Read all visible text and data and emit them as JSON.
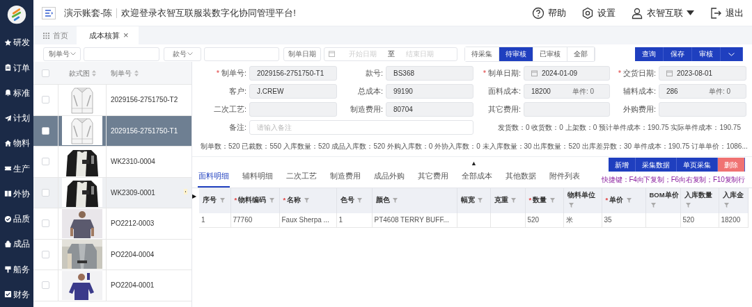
{
  "sidebar": {
    "items": [
      {
        "label": "研发"
      },
      {
        "label": "订单"
      },
      {
        "label": "标准"
      },
      {
        "label": "计划"
      },
      {
        "label": "物料"
      },
      {
        "label": "生产"
      },
      {
        "label": "外协"
      },
      {
        "label": "品质"
      },
      {
        "label": "成品"
      },
      {
        "label": "船务"
      },
      {
        "label": "财务"
      }
    ]
  },
  "header": {
    "account": "演示账套-陈",
    "welcome": "欢迎登录衣智互联服装数字化协同管理平台!",
    "actions": [
      {
        "kind": "help",
        "label": "帮助"
      },
      {
        "kind": "settings",
        "label": "设置"
      },
      {
        "kind": "user",
        "label": "衣智互联"
      },
      {
        "kind": "logout",
        "label": "退出"
      }
    ]
  },
  "page_tabs": [
    {
      "label": "首页",
      "selected": false
    },
    {
      "label": "成本核算",
      "selected": true,
      "close": "×"
    }
  ],
  "filters": {
    "order_select": "制单号",
    "style_select": "款号",
    "date_label": "制单日期",
    "start_placeholder": "开始日期",
    "range_sep": "至",
    "end_placeholder": "结束日期"
  },
  "status_filter": [
    {
      "label": "待采集",
      "selected": false
    },
    {
      "label": "待审核",
      "selected": true
    },
    {
      "label": "已审核",
      "selected": false
    },
    {
      "label": "全部",
      "selected": false
    }
  ],
  "actions": [
    {
      "label": "查询"
    },
    {
      "label": "保存"
    },
    {
      "label": "审核"
    }
  ],
  "required_mark": "*",
  "order_list": {
    "columns": [
      "款式图",
      "制单号"
    ],
    "select_all_checked": false,
    "rows": [
      {
        "order_no": "2029156-2751750-T2",
        "selected": false,
        "hovered": false
      },
      {
        "order_no": "2029156-2751750-T1",
        "selected": true,
        "hovered": false
      },
      {
        "order_no": "WK2310-0004",
        "selected": false,
        "hovered": false
      },
      {
        "order_no": "WK2309-0001",
        "selected": false,
        "hovered": true
      },
      {
        "order_no": "PO2212-0003",
        "selected": false,
        "hovered": false
      },
      {
        "order_no": "PO2204-0004",
        "selected": false,
        "hovered": false
      },
      {
        "order_no": "PO2204-0001",
        "selected": false,
        "hovered": false
      }
    ]
  },
  "form": {
    "fields": [
      {
        "label": "制单号:",
        "required": true,
        "kind": "text",
        "value": "2029156-2751750-T1"
      },
      {
        "label": "款号:",
        "required": false,
        "kind": "text",
        "value": "BS368"
      },
      {
        "label": "制单日期:",
        "required": true,
        "kind": "date",
        "value": "2024-01-09"
      },
      {
        "label": "交货日期:",
        "required": true,
        "kind": "date",
        "value": "2023-08-01"
      },
      {
        "label": "客户:",
        "required": false,
        "kind": "text",
        "value": "J.CREW"
      },
      {
        "label": "总成本:",
        "required": false,
        "kind": "text",
        "value": "99190"
      },
      {
        "label": "面料成本:",
        "required": false,
        "kind": "cost",
        "value": "18200",
        "unit": "单件: 0"
      },
      {
        "label": "辅料成本:",
        "required": false,
        "kind": "cost",
        "value": "286",
        "unit": "单件: 0"
      },
      {
        "label": "二次工艺:",
        "required": false,
        "kind": "text"
      },
      {
        "label": "制造费用:",
        "required": false,
        "kind": "text",
        "value": "80704"
      },
      {
        "label": "其它费用:",
        "required": false,
        "kind": "text"
      },
      {
        "label": "外购费用:",
        "required": false,
        "kind": "text"
      }
    ],
    "remark": {
      "label": "备注:",
      "placeholder": "请输入备注"
    },
    "shipping_summary": "发货数：0 收货数：0 上架数：0 预计单件成本：190.75 实际单件成本：190.75",
    "quantity_summary": "制单数：520 已裁数：550 入库数量：520 成品入库数：520 外购入库数：0 外协入库数：0 未入库数量：30 出库数量：520 出库差异数：30 单件成本：190.75 订单单价：1086..."
  },
  "collapse_toggle": "▲",
  "detail_tabs": [
    {
      "label": "面料明细",
      "selected": true
    },
    {
      "label": "辅料明细",
      "selected": false
    },
    {
      "label": "二次工艺",
      "selected": false
    },
    {
      "label": "制造费用",
      "selected": false
    },
    {
      "label": "成品外购",
      "selected": false
    },
    {
      "label": "其它费用",
      "selected": false
    },
    {
      "label": "全部成本",
      "selected": false
    },
    {
      "label": "其他数据",
      "selected": false
    },
    {
      "label": "附件列表",
      "selected": false
    }
  ],
  "detail_buttons": [
    {
      "label": "新增",
      "kind": "primary"
    },
    {
      "label": "采集数据",
      "kind": "primary"
    },
    {
      "label": "单页采集",
      "kind": "primary"
    },
    {
      "label": "删除",
      "kind": "danger"
    }
  ],
  "shortcut_hint": "快捷键：F4向下复制；F6向右复制；F10复制行",
  "table": {
    "row_marker": "▶",
    "columns": [
      {
        "label": "序号",
        "required": false
      },
      {
        "label": "物料编码",
        "required": true
      },
      {
        "label": "名称",
        "required": true
      },
      {
        "label": "色号",
        "required": false
      },
      {
        "label": "颜色",
        "required": false
      },
      {
        "label": "幅宽",
        "required": false
      },
      {
        "label": "克重",
        "required": false
      },
      {
        "label": "数量",
        "required": true
      },
      {
        "label": "物料单位",
        "required": false
      },
      {
        "label": "单价",
        "required": true
      },
      {
        "label": "BOM单价",
        "required": false
      },
      {
        "label": "入库数量",
        "required": false
      },
      {
        "label": "入库金",
        "required": false
      }
    ],
    "rows": [
      [
        "1",
        "77760",
        "Faux Sherpa ...",
        "1",
        "PT4608 TERRY BUFF...",
        null,
        null,
        "520",
        "米",
        "35",
        null,
        "520",
        "18200"
      ]
    ]
  }
}
